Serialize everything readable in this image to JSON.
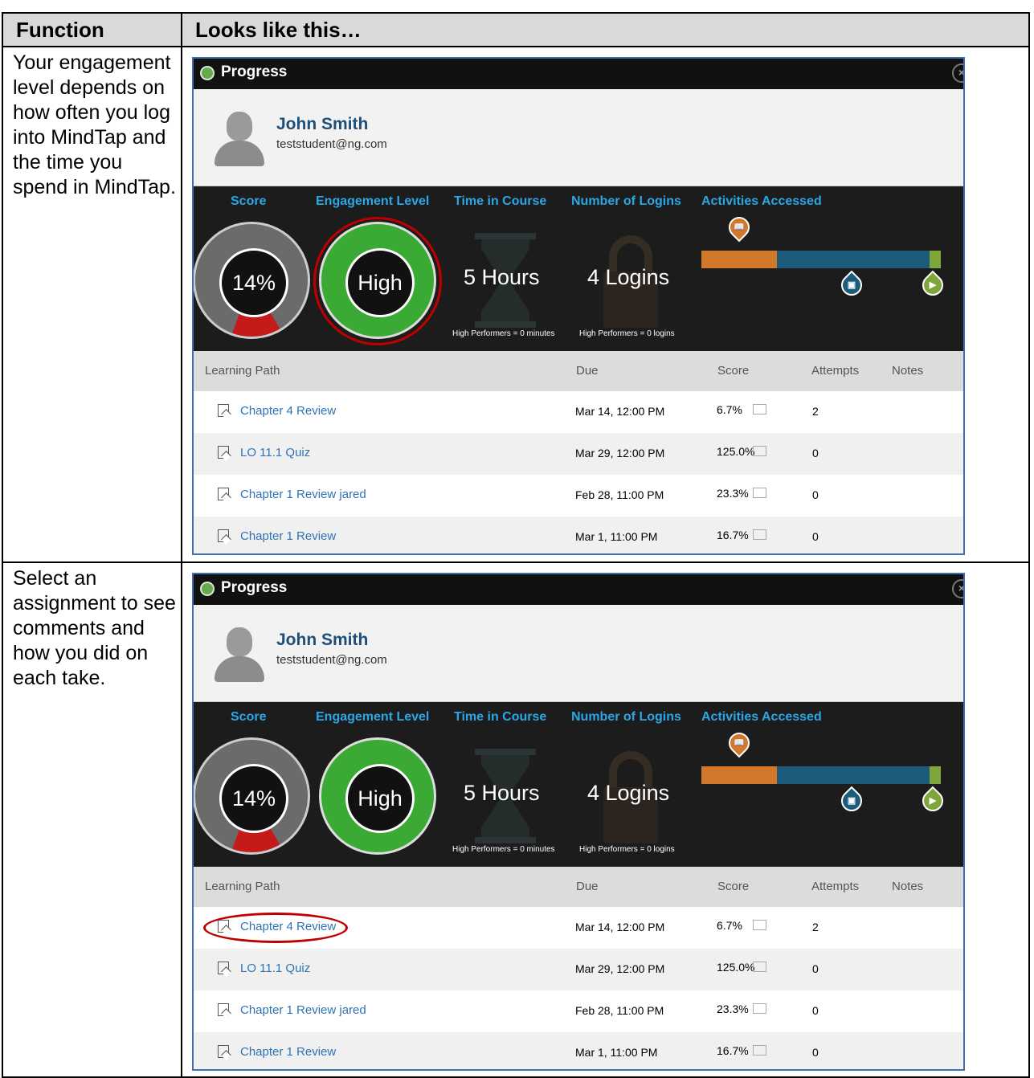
{
  "table": {
    "header_function": "Function",
    "header_looks": "Looks like this…"
  },
  "rows": [
    {
      "description": "Your engagement level depends on how often you log into MindTap and the time you spend in MindTap."
    },
    {
      "description": "Select an assignment to see comments and how you did on each take."
    }
  ],
  "panel": {
    "title": "Progress",
    "user_name": "John Smith",
    "user_email": "teststudent@ng.com",
    "stats": {
      "score_label": "Score",
      "score_value": "14%",
      "score_fraction": 0.14,
      "engagement_label": "Engagement Level",
      "engagement_value": "High",
      "time_label": "Time in Course",
      "time_value": "5 Hours",
      "time_note": "High Performers = 0 minutes",
      "logins_label": "Number of Logins",
      "logins_value": "4 Logins",
      "logins_note": "High Performers = 0 logins",
      "activities_label": "Activities Accessed"
    },
    "columns": [
      "Learning Path",
      "Due",
      "Score",
      "Attempts",
      "Notes"
    ],
    "assignments": [
      {
        "name": "Chapter 4 Review",
        "due": "Mar 14, 12:00 PM",
        "score": "6.7%",
        "attempts": "2"
      },
      {
        "name": "LO 11.1 Quiz",
        "due": "Mar 29, 12:00 PM",
        "score": "125.0%",
        "attempts": "0"
      },
      {
        "name": "Chapter 1 Review jared",
        "due": "Feb 28, 11:00 PM",
        "score": "23.3%",
        "attempts": "0"
      },
      {
        "name": "Chapter 1 Review",
        "due": "Mar 1, 11:00 PM",
        "score": "16.7%",
        "attempts": "0"
      }
    ]
  },
  "colors": {
    "accent_blue": "#2aa7e6",
    "engagement_green": "#3aaa35",
    "score_red": "#c41a1a",
    "highlight_red": "#c00000",
    "bar_orange": "#d2782a",
    "bar_teal": "#1d5b7a",
    "bar_green": "#7fa63a"
  }
}
